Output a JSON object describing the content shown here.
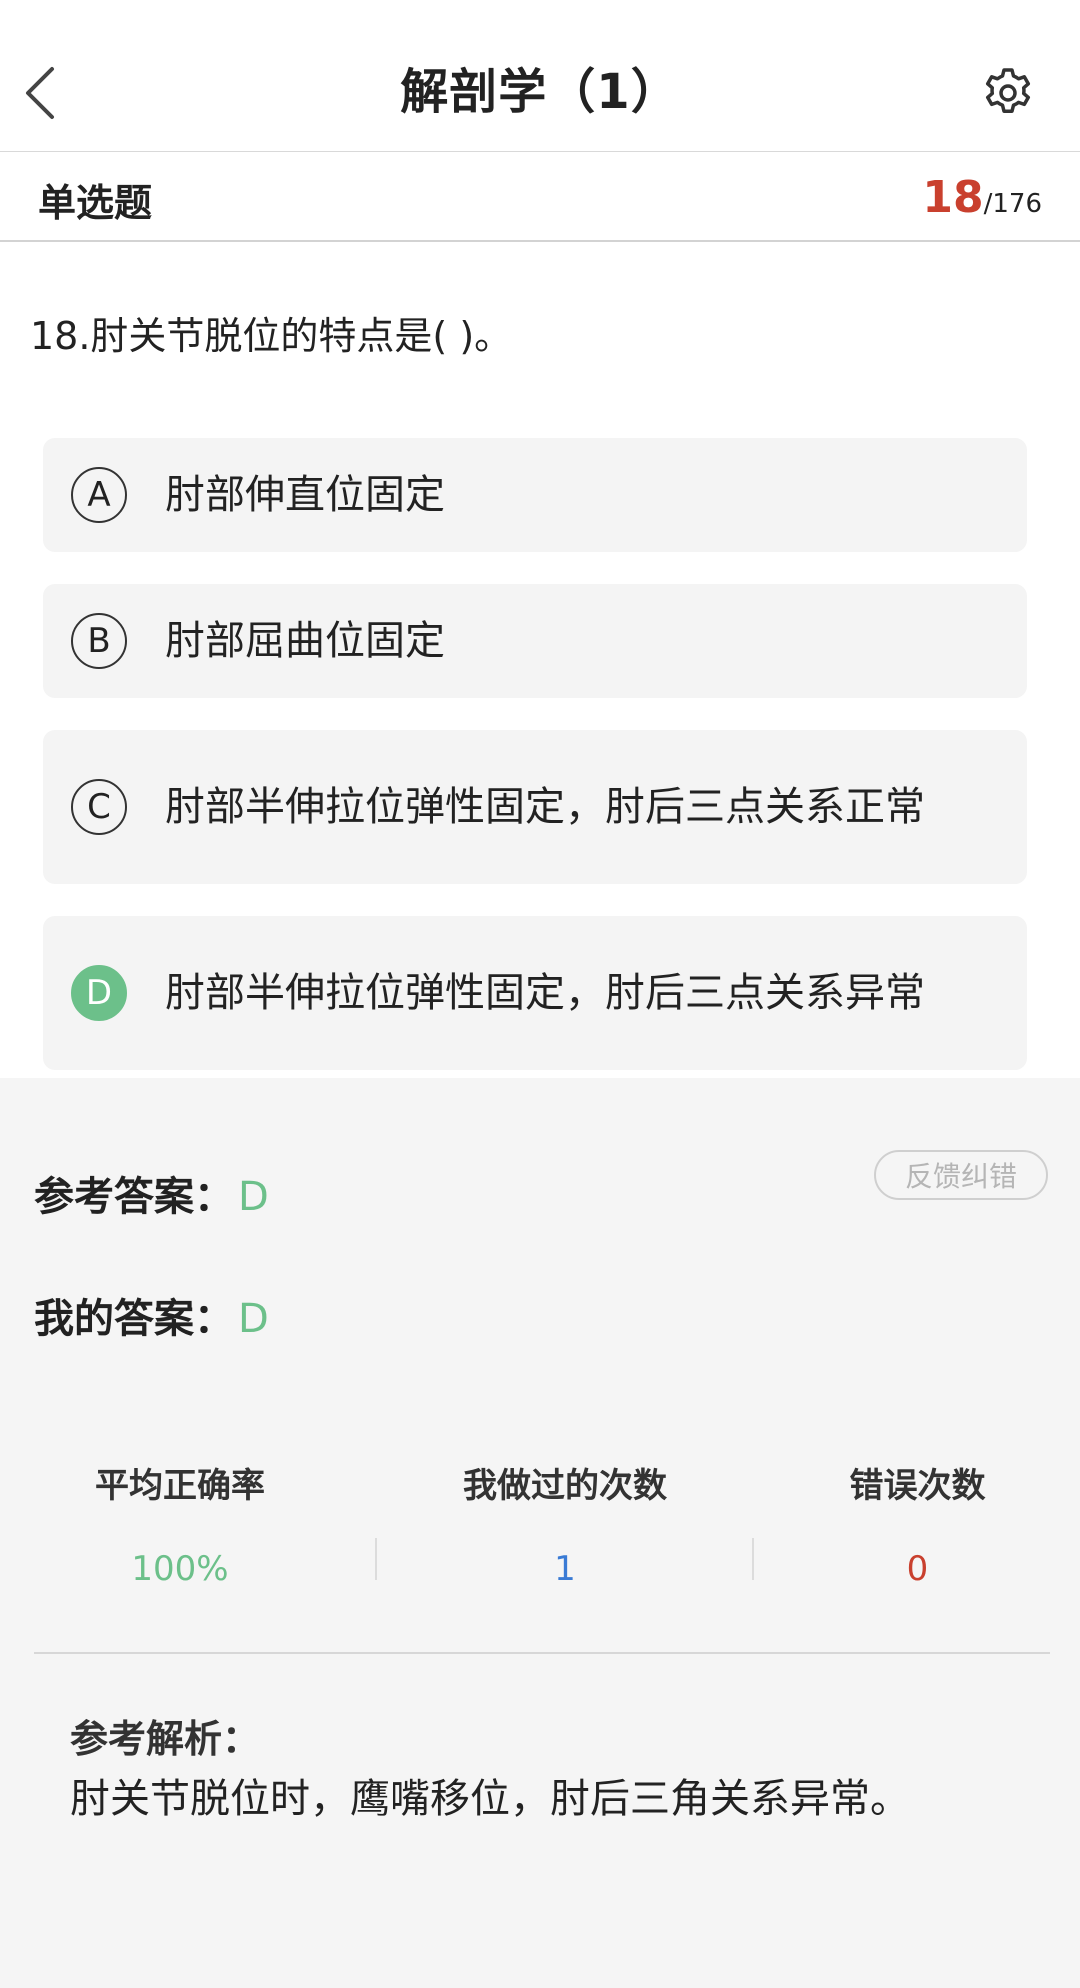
{
  "header": {
    "title": "解剖学（1）",
    "back_icon": "chevron-left-icon",
    "settings_icon": "gear-icon"
  },
  "question_meta": {
    "type": "单选题",
    "current": "18",
    "total": "/176"
  },
  "question": {
    "text": "18.肘关节脱位的特点是( )。",
    "options": [
      {
        "letter": "A",
        "text": "肘部伸直位固定"
      },
      {
        "letter": "B",
        "text": "肘部屈曲位固定"
      },
      {
        "letter": "C",
        "text": "肘部半伸拉位弹性固定，肘后三点关系正常"
      },
      {
        "letter": "D",
        "text": "肘部半伸拉位弹性固定，肘后三点关系异常"
      }
    ]
  },
  "answers": {
    "feedback_label": "反馈纠错",
    "reference_label": "参考答案：",
    "reference_value": "D",
    "mine_label": "我的答案：",
    "mine_value": "D"
  },
  "stats": [
    {
      "label": "平均正确率",
      "value": "100%"
    },
    {
      "label": "我做过的次数",
      "value": "1"
    },
    {
      "label": "错误次数",
      "value": "0"
    }
  ],
  "analysis": {
    "title": "参考解析：",
    "text": "肘关节脱位时，鹰嘴移位，肘后三角关系异常。"
  },
  "colors": {
    "accent_red": "#c9402e",
    "correct_green": "#6cc08a",
    "blue": "#3a7bd5"
  }
}
